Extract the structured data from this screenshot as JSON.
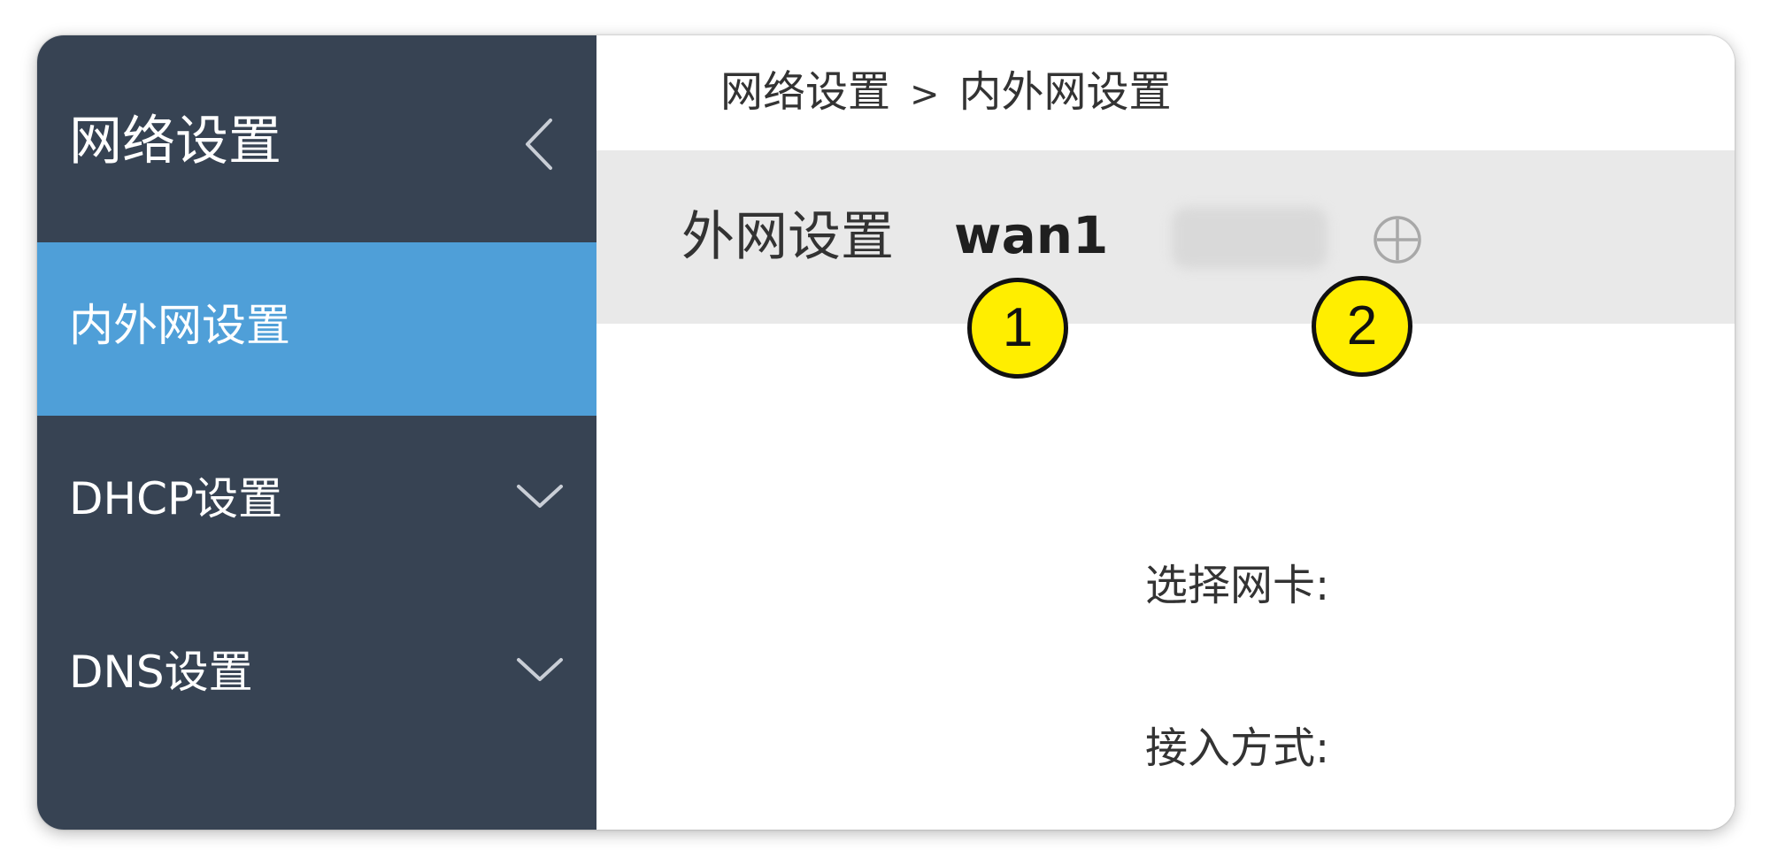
{
  "sidebar": {
    "title": "网络设置",
    "collapse_icon": "chevron-left-icon",
    "items": [
      {
        "label": "内外网设置",
        "active": true
      },
      {
        "label": "DHCP设置",
        "active": false,
        "icon": "chevron-down-icon"
      },
      {
        "label": "DNS设置",
        "active": false,
        "icon": "chevron-down-icon"
      }
    ]
  },
  "breadcrumb": {
    "parent": "网络设置",
    "separator": ">",
    "current": "内外网设置"
  },
  "wan_section": {
    "label": "外网设置",
    "tabs": [
      {
        "label": "wan1",
        "active": true
      }
    ],
    "add_icon": "circle-plus-icon"
  },
  "form": {
    "nic_label": "选择网卡:",
    "access_label": "接入方式:"
  },
  "markers": [
    "1",
    "2"
  ],
  "colors": {
    "sidebar_bg": "#374353",
    "active_item_bg": "#4f9fd8",
    "tabbar_bg": "#e9e9e9",
    "marker_fill": "#ffee00"
  }
}
